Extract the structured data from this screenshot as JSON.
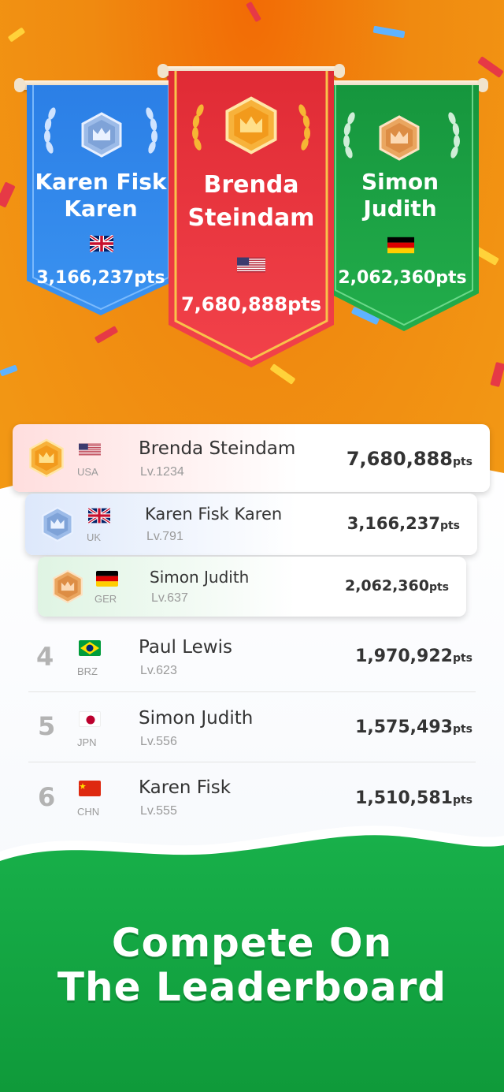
{
  "podium": [
    {
      "place": "2",
      "name": "Karen Fisk Karen",
      "flag": "gb-flag-icon",
      "points": "3,166,237pts",
      "medal": "silver-crown-medal-icon",
      "color": "#2f86e8"
    },
    {
      "place": "1",
      "name": "Brenda Steindam",
      "flag": "us-flag-icon",
      "points": "7,680,888pts",
      "medal": "gold-crown-medal-icon",
      "color": "#e9323b"
    },
    {
      "place": "3",
      "name": "Simon Judith",
      "flag": "de-flag-icon",
      "points": "2,062,360pts",
      "medal": "bronze-crown-medal-icon",
      "color": "#1ea445"
    }
  ],
  "podium_lines": {
    "second": [
      "Karen Fisk",
      "Karen"
    ],
    "first": [
      "Brenda",
      "Steindam"
    ],
    "third": [
      "Simon",
      "Judith"
    ]
  },
  "leaderboard": [
    {
      "rank": "1",
      "name": "Brenda Steindam",
      "country": "USA",
      "level": "Lv.1234",
      "score": "7,680,888",
      "unit": "pts"
    },
    {
      "rank": "2",
      "name": "Karen Fisk Karen",
      "country": "UK",
      "level": "Lv.791",
      "score": "3,166,237",
      "unit": "pts"
    },
    {
      "rank": "3",
      "name": "Simon Judith",
      "country": "GER",
      "level": "Lv.637",
      "score": "2,062,360",
      "unit": "pts"
    },
    {
      "rank": "4",
      "name": "Paul Lewis",
      "country": "BRZ",
      "level": "Lv.623",
      "score": "1,970,922",
      "unit": "pts"
    },
    {
      "rank": "5",
      "name": "Simon Judith",
      "country": "JPN",
      "level": "Lv.556",
      "score": "1,575,493",
      "unit": "pts"
    },
    {
      "rank": "6",
      "name": "Karen Fisk",
      "country": "CHN",
      "level": "Lv.555",
      "score": "1,510,581",
      "unit": "pts"
    }
  ],
  "headline": {
    "line1": "Compete On",
    "line2": "The Leaderboard"
  },
  "colors": {
    "orange": "#f08a10",
    "green": "#1ea445",
    "gold": "#f6b43a",
    "silver": "#9bb9e6",
    "bronze": "#e9a05c"
  }
}
